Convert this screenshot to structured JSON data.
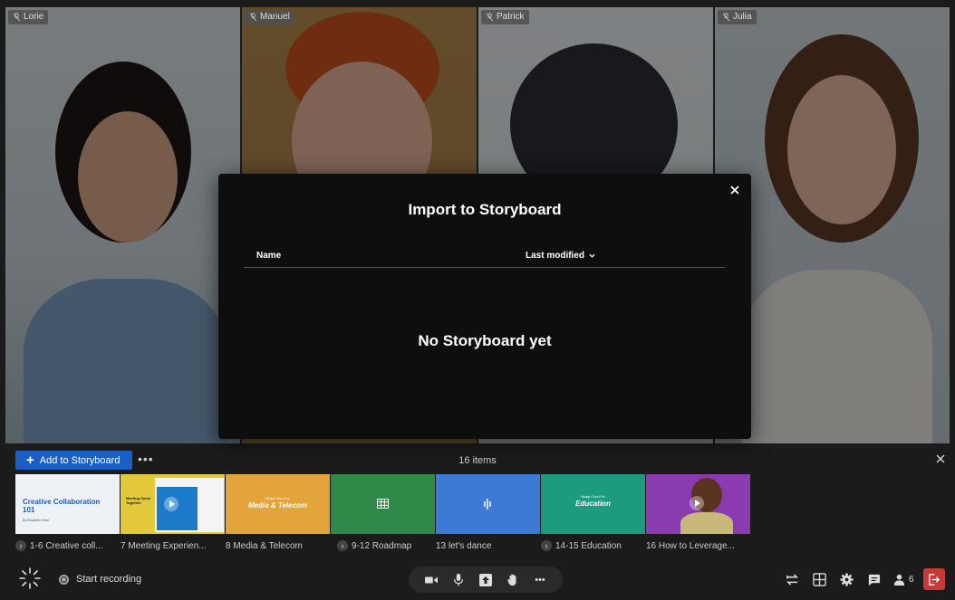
{
  "participants": [
    {
      "name": "Lorie"
    },
    {
      "name": "Manuel"
    },
    {
      "name": "Patrick"
    },
    {
      "name": "Julia"
    }
  ],
  "modal": {
    "title": "Import to Storyboard",
    "col_name": "Name",
    "col_modified": "Last modified",
    "empty": "No Storyboard yet"
  },
  "storyboard": {
    "add_label": "Add to Storyboard",
    "more": "•••",
    "count": "16 items",
    "thumbs": [
      {
        "title": "Creative Collaboration 101",
        "subtitle": "By Elisabeth Oliver",
        "bg": "#eef2f7",
        "fg": "#1a5fc4"
      },
      {
        "title": "Meeting Some Together",
        "bg": "#e2c93b",
        "fg": "#1b1b1b"
      },
      {
        "title": "Media & Telecom",
        "subtitle": "Wrapp Cloud For",
        "bg": "#e3a43b",
        "fg": "#ffffff"
      },
      {
        "title": "",
        "bg": "#2f8a4a",
        "fg": "#ffffff"
      },
      {
        "title": "",
        "bg": "#3d7ad6",
        "fg": "#ffffff"
      },
      {
        "title": "Education",
        "subtitle": "Wrapp Cloud For",
        "bg": "#1d9b7f",
        "fg": "#ffffff"
      },
      {
        "title": "",
        "bg": "#8b3bb0",
        "fg": "#ffffff"
      }
    ],
    "captions": [
      {
        "text": "1-6 Creative coll...",
        "group": true
      },
      {
        "text": "7 Meeting Experien...",
        "group": false
      },
      {
        "text": "8 Media & Telecom",
        "group": false
      },
      {
        "text": "9-12 Roadmap",
        "group": true
      },
      {
        "text": "13 let's dance",
        "group": false
      },
      {
        "text": "14-15 Education",
        "group": true
      },
      {
        "text": "16 How to Leverage...",
        "group": false
      }
    ]
  },
  "toolbar": {
    "record_label": "Start recording",
    "people_count": "6",
    "more": "•••"
  },
  "colors": {
    "accent": "#1a5fc4",
    "leave": "#c63a3a"
  }
}
